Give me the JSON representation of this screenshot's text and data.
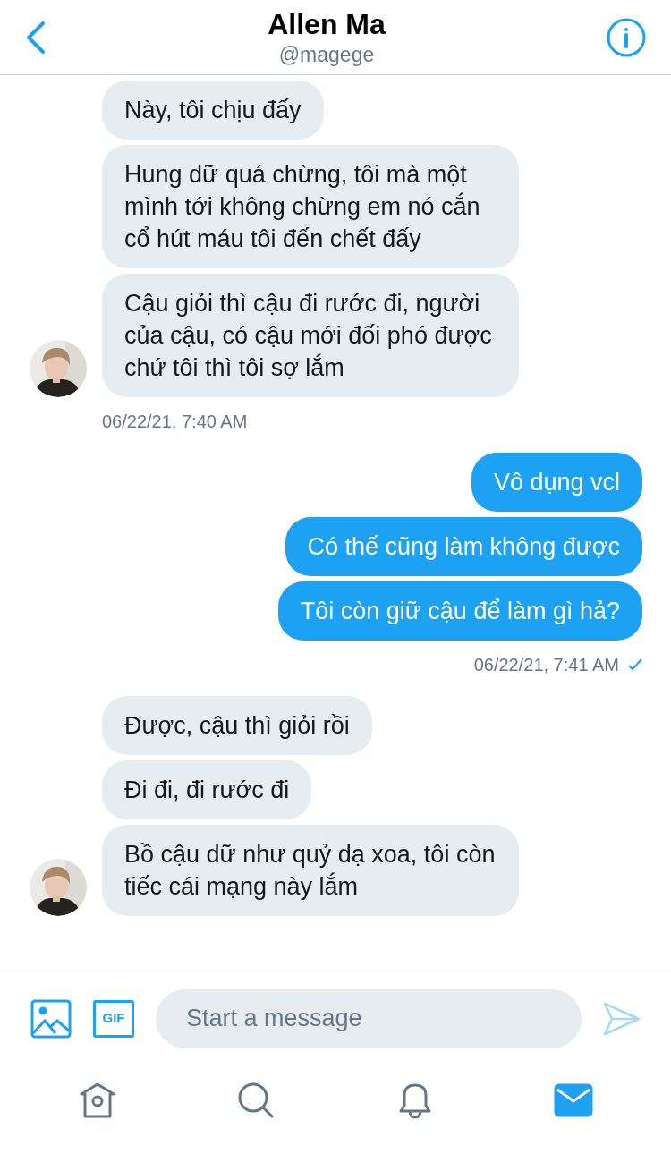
{
  "header": {
    "title": "Allen Ma",
    "handle": "@magege"
  },
  "groups": [
    {
      "kind": "received",
      "messages": [
        "Này, tôi chịu đấy",
        "Hung dữ quá chừng, tôi mà một mình tới không chừng em nó cắn cổ hút máu tôi đến chết đấy",
        "Cậu giỏi thì cậu đi rước đi, người của cậu, có cậu mới đối phó được chứ tôi thì tôi sợ lắm"
      ],
      "timestamp": "06/22/21, 7:40 AM"
    },
    {
      "kind": "sent",
      "messages": [
        "Vô dụng vcl",
        "Có thế cũng làm không được",
        "Tôi còn giữ cậu để làm gì hả?"
      ],
      "timestamp": "06/22/21, 7:41 AM",
      "read": true
    },
    {
      "kind": "received",
      "messages": [
        "Được, cậu thì giỏi rồi",
        "Đi đi, đi rước đi",
        "Bồ cậu dữ như quỷ dạ xoa, tôi còn tiếc cái mạng này lắm"
      ]
    }
  ],
  "composer": {
    "placeholder": "Start a message",
    "gif_label": "GIF"
  },
  "tabs": [
    {
      "kind": "home",
      "selected": false
    },
    {
      "kind": "search",
      "selected": false
    },
    {
      "kind": "notifications",
      "selected": false
    },
    {
      "kind": "messages",
      "selected": true
    }
  ]
}
